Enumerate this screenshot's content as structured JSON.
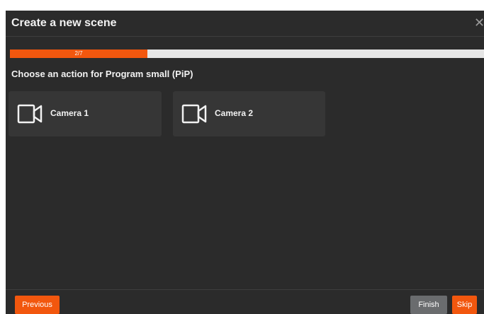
{
  "dialog": {
    "title": "Create a new scene",
    "close_glyph": "✕",
    "close_icon": "close-icon"
  },
  "progress": {
    "label": "2/7",
    "current_step": 2,
    "total_steps": 7,
    "fill_fraction": 0.29,
    "color": "#f2570e"
  },
  "prompt": "Choose an action for Program small (PiP)",
  "options": [
    {
      "label": "Camera 1",
      "icon": "camera-icon"
    },
    {
      "label": "Camera 2",
      "icon": "camera-icon"
    }
  ],
  "footer": {
    "previous_label": "Previous",
    "finish_label": "Finish",
    "skip_label": "Skip"
  },
  "colors": {
    "accent": "#f2570e",
    "background": "#2b2b2b",
    "card": "#363636",
    "secondary_button": "#6a6c6e"
  }
}
